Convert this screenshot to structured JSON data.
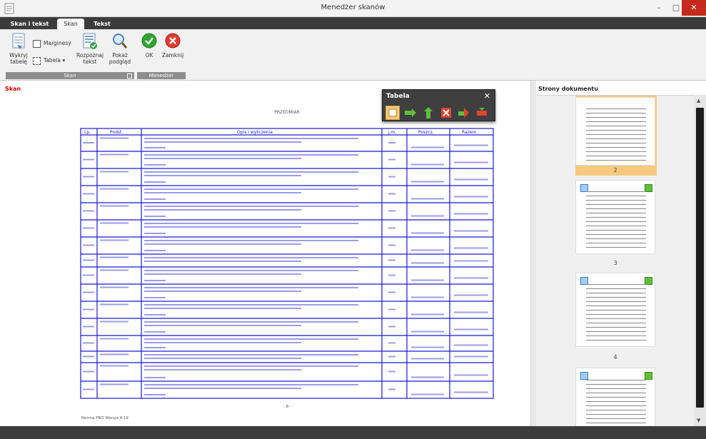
{
  "window": {
    "title": "Menedżer skanów"
  },
  "tabs": [
    "Skan i tekst",
    "Skan",
    "Tekst"
  ],
  "ribbon": {
    "group_skan": {
      "label": "Skan",
      "detect_table": "Wykryj tabelę",
      "margins": "Marginesy",
      "table": "Tabela",
      "recognize_text": "Rozpoznaj tekst",
      "preview": "Pokaż podgląd"
    },
    "group_manager": {
      "label": "Menedżer",
      "ok": "OK",
      "close": "Zamknij"
    }
  },
  "scan_panel": {
    "title": "Skan"
  },
  "pages_panel": {
    "title": "Strony dokumentu",
    "pages": [
      "2",
      "3",
      "4"
    ]
  },
  "table_toolbar": {
    "title": "Tabela"
  },
  "document": {
    "header_label": "PRZEDMIAR",
    "footer_text": "Norma PRO Wersja 4.19",
    "page_number": "- 8 -",
    "column_headers": [
      "Lp.",
      "Podst.",
      "Opis i wyliczenia",
      "j.m.",
      "Poszcz.",
      "Razem"
    ]
  },
  "colors": {
    "accent": "#1a1ad0",
    "selected": "#f6c97e",
    "title_red": "#cc0000"
  }
}
